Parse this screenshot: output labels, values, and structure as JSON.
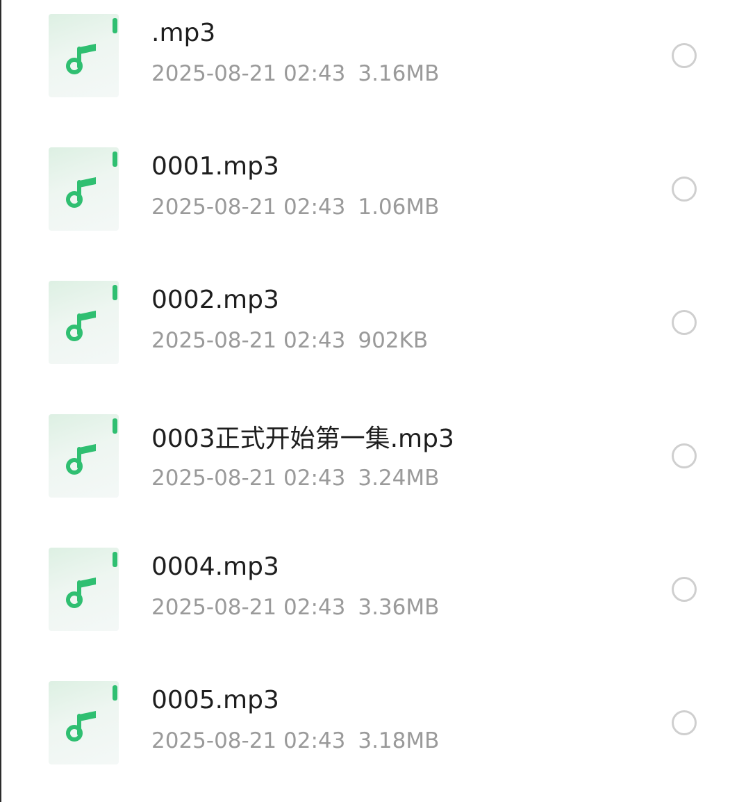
{
  "files": [
    {
      "name": ".mp3",
      "date": "2025-08-21 02:43",
      "size": "3.16MB",
      "icon": "music-note-icon",
      "selected": false
    },
    {
      "name": "0001.mp3",
      "date": "2025-08-21 02:43",
      "size": "1.06MB",
      "icon": "music-note-icon",
      "selected": false
    },
    {
      "name": "0002.mp3",
      "date": "2025-08-21 02:43",
      "size": "902KB",
      "icon": "music-note-icon",
      "selected": false
    },
    {
      "name": "0003正式开始第一集.mp3",
      "date": "2025-08-21 02:43",
      "size": "3.24MB",
      "icon": "music-note-icon",
      "selected": false
    },
    {
      "name": "0004.mp3",
      "date": "2025-08-21 02:43",
      "size": "3.36MB",
      "icon": "music-note-icon",
      "selected": false
    },
    {
      "name": "0005.mp3",
      "date": "2025-08-21 02:43",
      "size": "3.18MB",
      "icon": "music-note-icon",
      "selected": false
    }
  ],
  "colors": {
    "accent": "#2fbf71",
    "icon_bg": "#eef6f1",
    "title_text": "#1e1e1e",
    "meta_text": "#9a9a9a",
    "radio_border": "#cfcfcf"
  }
}
